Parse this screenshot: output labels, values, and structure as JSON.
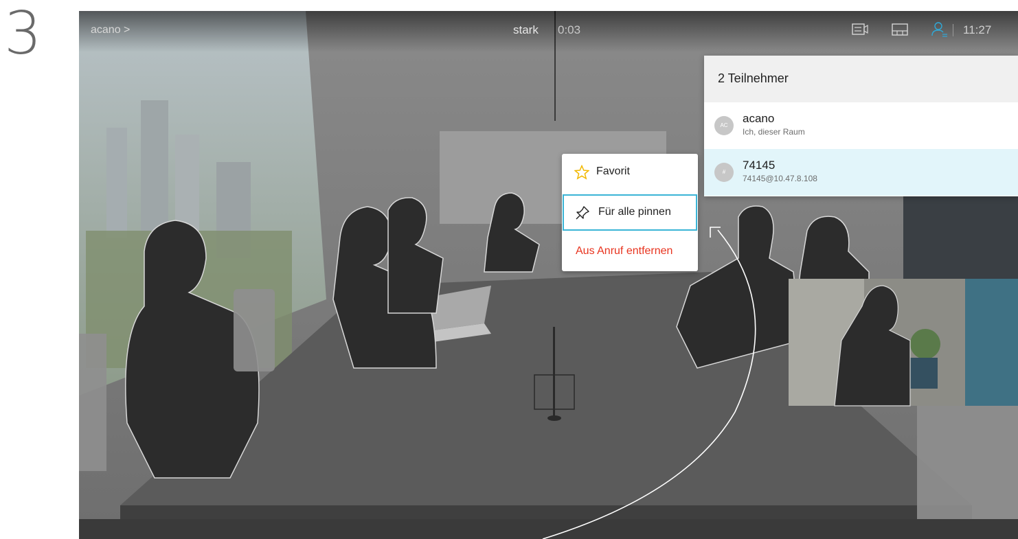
{
  "step": {
    "number": "3"
  },
  "topbar": {
    "breadcrumb": "acano >",
    "call_name": "stark",
    "call_duration": "0:03",
    "clock": "11:27",
    "icons": [
      "camera-control-icon",
      "layout-icon",
      "participants-icon"
    ]
  },
  "participants": {
    "header": "2 Teilnehmer",
    "items": [
      {
        "avatar": "AC",
        "name": "acano",
        "subtitle": "Ich, dieser Raum",
        "selected": false
      },
      {
        "avatar": "#",
        "name": "74145",
        "subtitle": "74145@10.47.8.108",
        "selected": true
      }
    ]
  },
  "context_menu": {
    "items": [
      {
        "label": "Favorit",
        "icon": "star-icon"
      },
      {
        "label": "Für alle pinnen",
        "icon": "pin-icon",
        "focused": true
      },
      {
        "label": "Aus Anruf entfernen",
        "icon": null,
        "danger": true
      }
    ]
  },
  "colors": {
    "accent": "#3ab4d6",
    "danger": "#e8331e",
    "selected_row": "#e2f5fa",
    "star": "#f2b800",
    "active_icon": "#2fa9d8"
  }
}
